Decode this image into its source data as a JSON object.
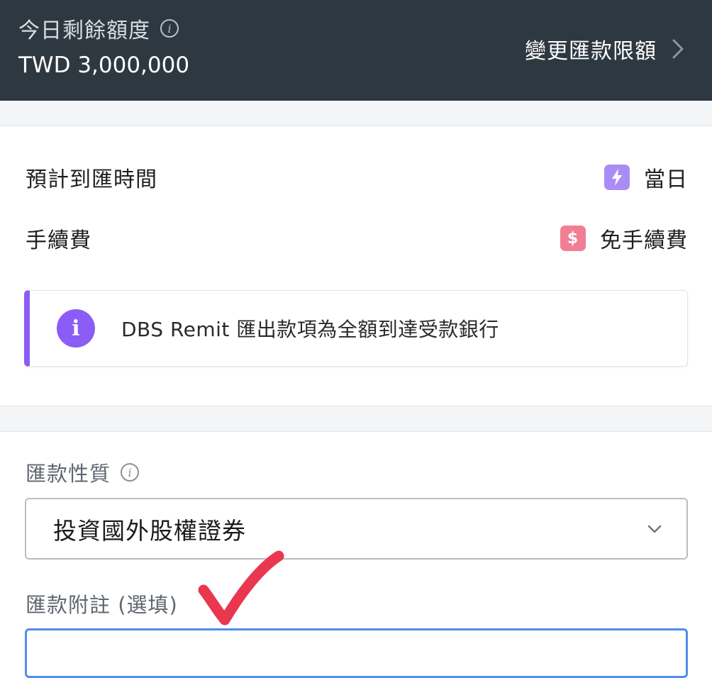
{
  "header": {
    "quota_label": "今日剩餘額度",
    "quota_amount": "TWD 3,000,000",
    "change_limit_label": "變更匯款限額"
  },
  "summary": {
    "arrival_label": "預計到匯時間",
    "arrival_value": "當日",
    "fee_label": "手續費",
    "fee_value": "免手續費",
    "fee_badge_symbol": "$"
  },
  "notice": {
    "icon_glyph": "i",
    "text": "DBS Remit 匯出款項為全額到達受款銀行"
  },
  "form": {
    "purpose_label": "匯款性質",
    "purpose_value": "投資國外股權證券",
    "remark_label": "匯款附註 (選填)",
    "remark_value": ""
  },
  "colors": {
    "header_bg": "#2e3840",
    "accent_purple": "#8b5cf6",
    "badge_pink": "#f07f94",
    "focus_blue": "#4f8fea",
    "annotation_red": "#e8374f"
  },
  "icons": {
    "quota_info": "info-icon",
    "change_limit": "chevron-right-icon",
    "arrival": "lightning-icon",
    "fee": "dollar-icon",
    "notice": "info-icon",
    "purpose_info": "info-icon",
    "select": "chevron-down-icon",
    "annotation": "checkmark-icon"
  }
}
